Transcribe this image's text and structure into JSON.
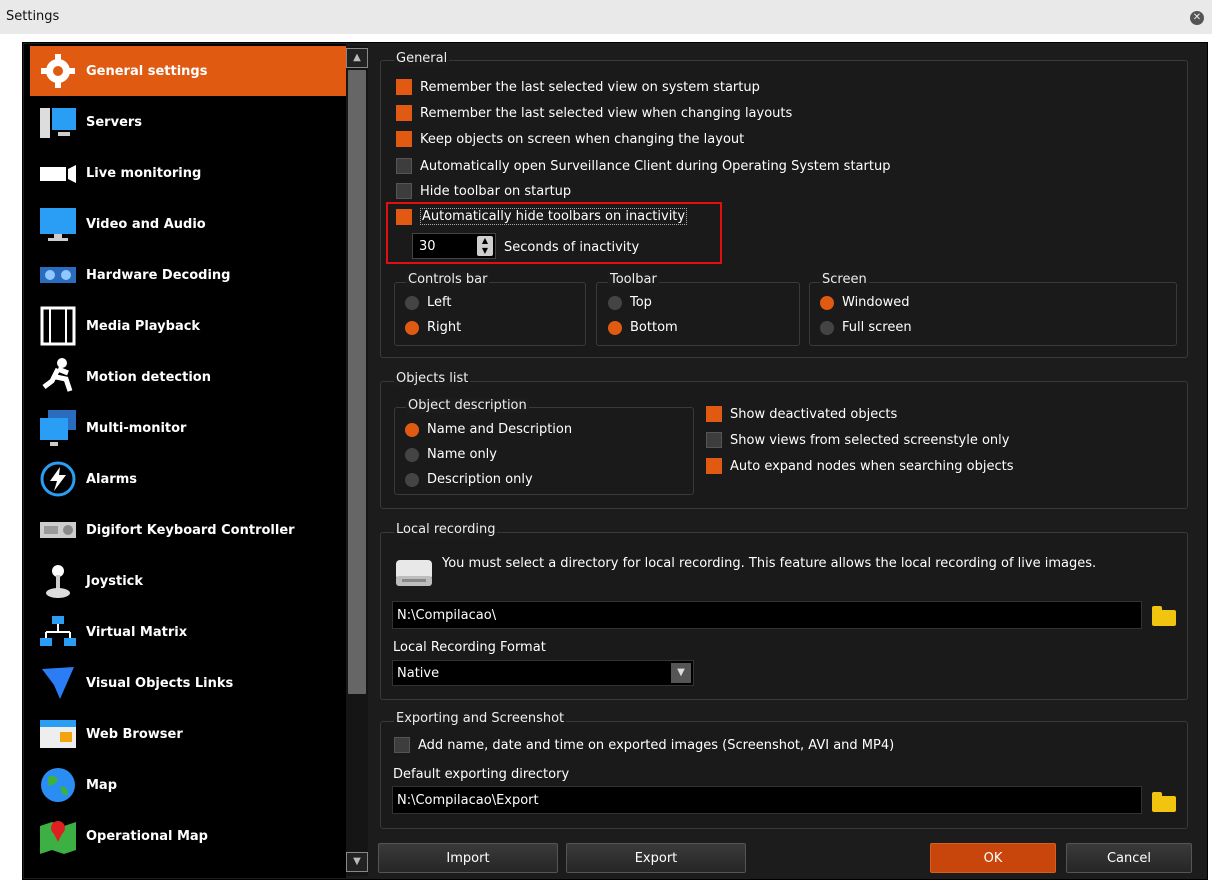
{
  "window": {
    "title": "Settings",
    "close_icon": "close-icon"
  },
  "sidebar": {
    "items": [
      {
        "label": "General settings",
        "icon": "gear-icon",
        "active": true
      },
      {
        "label": "Servers",
        "icon": "server-monitor-icon"
      },
      {
        "label": "Live monitoring",
        "icon": "camera-icon"
      },
      {
        "label": "Video and Audio",
        "icon": "monitor-icon"
      },
      {
        "label": "Hardware Decoding",
        "icon": "graphics-card-icon"
      },
      {
        "label": "Media Playback",
        "icon": "film-strip-icon"
      },
      {
        "label": "Motion detection",
        "icon": "running-person-icon"
      },
      {
        "label": "Multi-monitor",
        "icon": "multi-monitor-icon"
      },
      {
        "label": "Alarms",
        "icon": "lightning-alarm-icon"
      },
      {
        "label": "Digifort Keyboard Controller",
        "icon": "keyboard-controller-icon"
      },
      {
        "label": "Joystick",
        "icon": "joystick-icon"
      },
      {
        "label": "Virtual Matrix",
        "icon": "network-matrix-icon"
      },
      {
        "label": "Visual Objects Links",
        "icon": "link-arrow-icon"
      },
      {
        "label": "Web Browser",
        "icon": "browser-window-icon"
      },
      {
        "label": "Map",
        "icon": "globe-icon"
      },
      {
        "label": "Operational Map",
        "icon": "map-pin-icon"
      }
    ]
  },
  "general": {
    "title": "General",
    "options": [
      {
        "label": "Remember the last selected view on system startup",
        "checked": true
      },
      {
        "label": "Remember the last selected view when changing layouts",
        "checked": true
      },
      {
        "label": "Keep objects on screen when changing the layout",
        "checked": true
      },
      {
        "label": "Automatically open Surveillance Client during Operating System startup",
        "checked": false
      },
      {
        "label": "Hide toolbar on startup",
        "checked": false
      },
      {
        "label": "Automatically hide toolbars on inactivity",
        "checked": true
      }
    ],
    "inactivity": {
      "value": "30",
      "label": "Seconds of inactivity"
    },
    "controls_bar": {
      "title": "Controls bar",
      "options": [
        "Left",
        "Right"
      ],
      "selected": "Right"
    },
    "toolbar": {
      "title": "Toolbar",
      "options": [
        "Top",
        "Bottom"
      ],
      "selected": "Bottom"
    },
    "screen": {
      "title": "Screen",
      "options": [
        "Windowed",
        "Full screen"
      ],
      "selected": "Windowed"
    }
  },
  "objects_list": {
    "title": "Objects list",
    "description": {
      "title": "Object description",
      "options": [
        "Name and Description",
        "Name only",
        "Description only"
      ],
      "selected": "Name and Description"
    },
    "checks": [
      {
        "label": "Show deactivated objects",
        "checked": true
      },
      {
        "label": "Show views from selected screenstyle only",
        "checked": false
      },
      {
        "label": "Auto expand nodes when searching objects",
        "checked": true
      }
    ]
  },
  "local_recording": {
    "title": "Local recording",
    "message": "You must select a directory for local recording. This feature allows the local recording of live images.",
    "directory": "N:\\Compilacao\\",
    "format_label": "Local Recording Format",
    "format_value": "Native"
  },
  "exporting": {
    "title": "Exporting and Screenshot",
    "add_info_label": "Add name, date and time on exported images (Screenshot, AVI and MP4)",
    "add_info_checked": false,
    "dir_label": "Default exporting directory",
    "directory": "N:\\Compilacao\\Export"
  },
  "buttons": {
    "import": "Import",
    "export": "Export",
    "ok": "OK",
    "cancel": "Cancel"
  },
  "colors": {
    "accent": "#e05a12",
    "background": "#1c1c1c",
    "highlight": "#e01010"
  }
}
